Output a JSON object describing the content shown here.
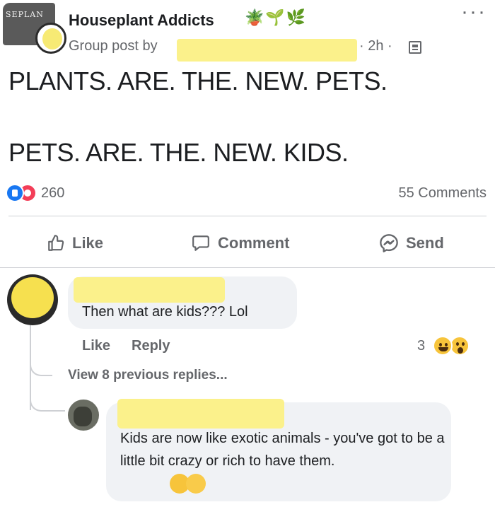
{
  "post": {
    "group_name": "Houseplant Addicts",
    "group_emojis": "🪴🌱🌿",
    "avatar_cover_text": "SEPLAN",
    "meta_prefix": "Group post by",
    "time": "· 2h ·",
    "text_line1": "PLANTS. ARE. THE. NEW. PETS.",
    "text_line2": "PETS. ARE. THE. NEW. KIDS.",
    "more_icon": "···"
  },
  "stats": {
    "reactions_count": "260",
    "comments_count": "55 Comments"
  },
  "actions": {
    "like_label": "Like",
    "comment_label": "Comment",
    "send_label": "Send"
  },
  "comments": [
    {
      "text": "Then what are kids??? Lol",
      "like_label": "Like",
      "reply_label": "Reply",
      "reaction_count": "3",
      "view_replies": "View 8 previous replies..."
    },
    {
      "text": "Kids are now like exotic animals - you've got to be a little bit crazy or rich to have them."
    }
  ],
  "colors": {
    "like_blue": "#1877f2",
    "love_red": "#f33e58",
    "redaction_yellow": "#fbf18b",
    "bubble_bg": "#f0f2f5",
    "meta_gray": "#65676b"
  },
  "icons": [
    "group-avatar",
    "privacy-icon",
    "more-icon",
    "like-reaction-icon",
    "love-reaction-icon",
    "thumbs-up-icon",
    "comment-icon",
    "messenger-icon",
    "haha-emoji-icon",
    "wow-emoji-icon",
    "wink-emoji-icon",
    "laugh-emoji-icon"
  ]
}
